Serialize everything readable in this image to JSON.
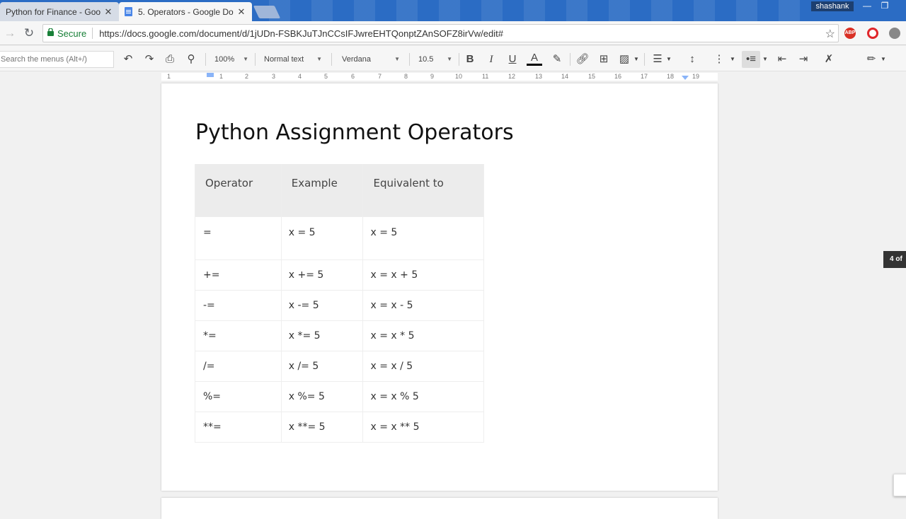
{
  "tabs": [
    {
      "title": "Python for Finance - Goo",
      "close": "✕"
    },
    {
      "title": "5. Operators - Google Do",
      "close": "✕"
    }
  ],
  "profile_name": "shashank",
  "window_controls": {
    "minimize": "—",
    "maximize": "❐"
  },
  "address_bar": {
    "secure_label": "Secure",
    "url": "https://docs.google.com/document/d/1jUDn-FSBKJuTJnCCsIFJwreEHTQonptZAnSOFZ8irVw/edit#"
  },
  "extensions": {
    "abp": "ABP"
  },
  "toolbar": {
    "menu_search_placeholder": "Search the menus (Alt+/)",
    "zoom": "100%",
    "style": "Normal text",
    "font": "Verdana",
    "font_size": "10.5",
    "bold": "B",
    "italic": "I",
    "underline": "U",
    "text_color": "A"
  },
  "ruler": {
    "numbers": [
      "1",
      "1",
      "2",
      "3",
      "4",
      "5",
      "6",
      "7",
      "8",
      "9",
      "10",
      "11",
      "12",
      "13",
      "14",
      "15",
      "16",
      "17",
      "18",
      "19"
    ]
  },
  "document": {
    "title": "Python Assignment Operators",
    "table": {
      "headers": [
        "Operator",
        "Example",
        "Equivalent to"
      ],
      "rows": [
        [
          "=",
          "x = 5",
          "x = 5"
        ],
        [
          "+=",
          "x += 5",
          "x = x + 5"
        ],
        [
          "-=",
          "x -= 5",
          "x = x - 5"
        ],
        [
          "*=",
          "x *= 5",
          "x = x * 5"
        ],
        [
          "/=",
          "x /= 5",
          "x = x / 5"
        ],
        [
          "%=",
          "x %= 5",
          "x = x % 5"
        ],
        [
          "**=",
          "x **= 5",
          "x = x ** 5"
        ]
      ]
    }
  },
  "page_indicator": "4 of",
  "colors": {
    "chrome_frame": "#2b6cc4",
    "secure_green": "#188038",
    "doc_icon": "#4a86e8"
  }
}
